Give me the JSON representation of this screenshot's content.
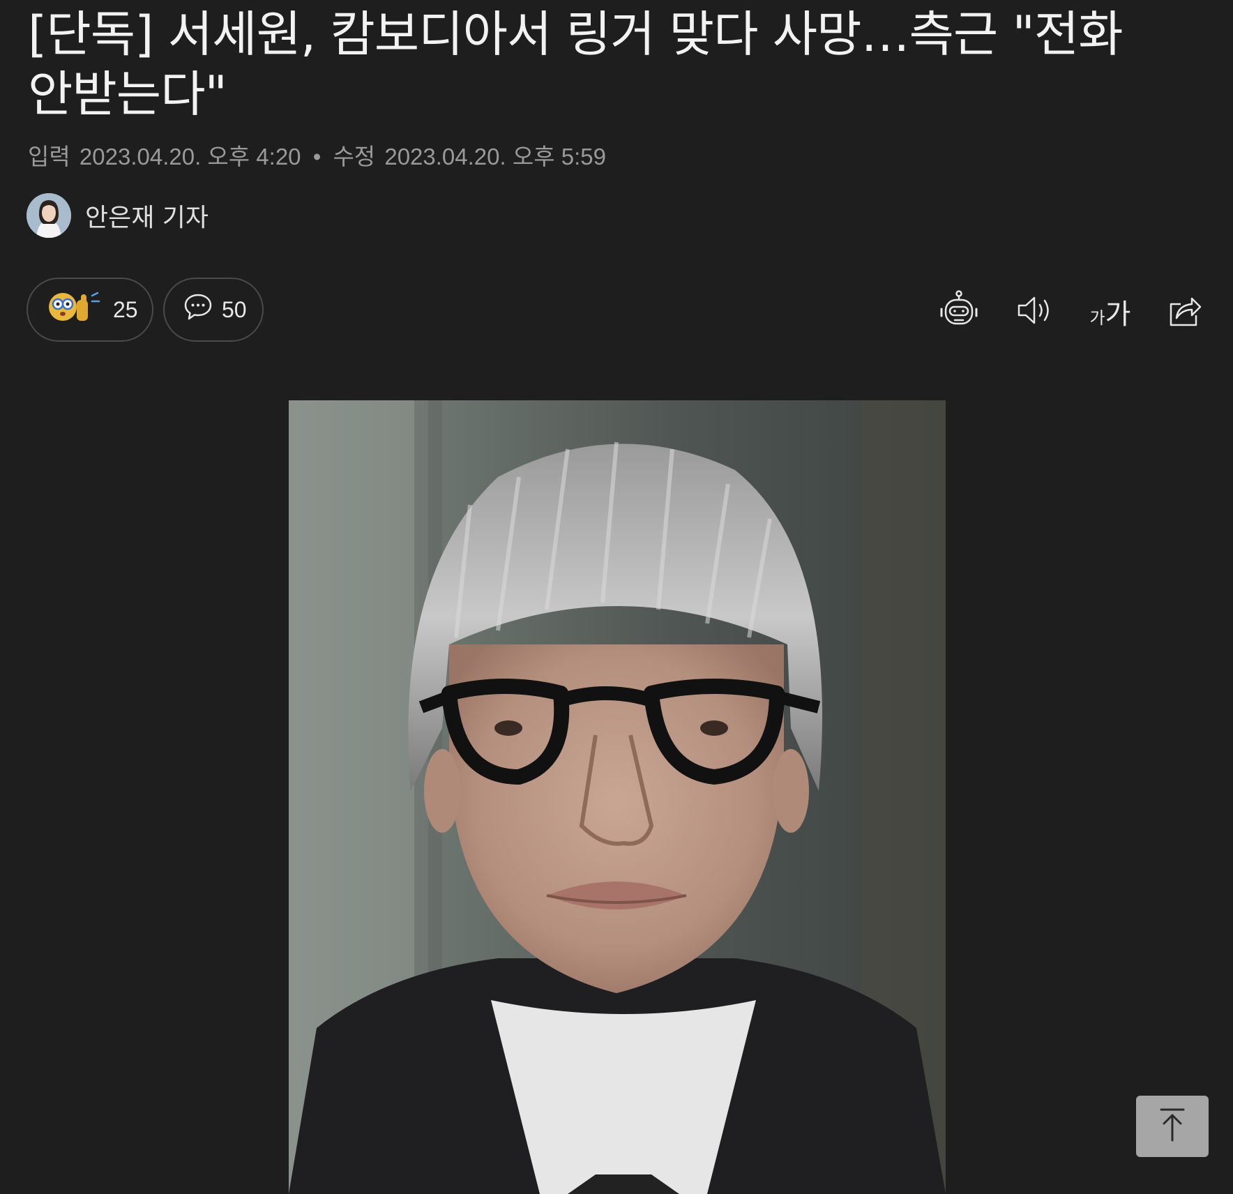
{
  "article": {
    "headline": "[단독] 서세원, 캄보디아서 링거 맞다 사망…측근 \"전화 안받는다\"",
    "meta": {
      "input_label": "입력",
      "input_time": "2023.04.20. 오후 4:20",
      "separator": "•",
      "modified_label": "수정",
      "modified_time": "2023.04.20. 오후 5:59"
    },
    "author": {
      "name": "안은재 기자"
    }
  },
  "actions": {
    "reaction_count": "25",
    "comment_count": "50"
  },
  "toolbar": {
    "font_small": "가",
    "font_large": "가",
    "icons": [
      "robot-summary-icon",
      "speaker-icon",
      "font-size-icon",
      "share-icon"
    ]
  },
  "colors": {
    "background": "#1e1e1e",
    "text": "#f2f2f2",
    "muted": "#9a9a9a",
    "pill_border": "#4a4a4a",
    "top_button": "#a6a6a6"
  }
}
